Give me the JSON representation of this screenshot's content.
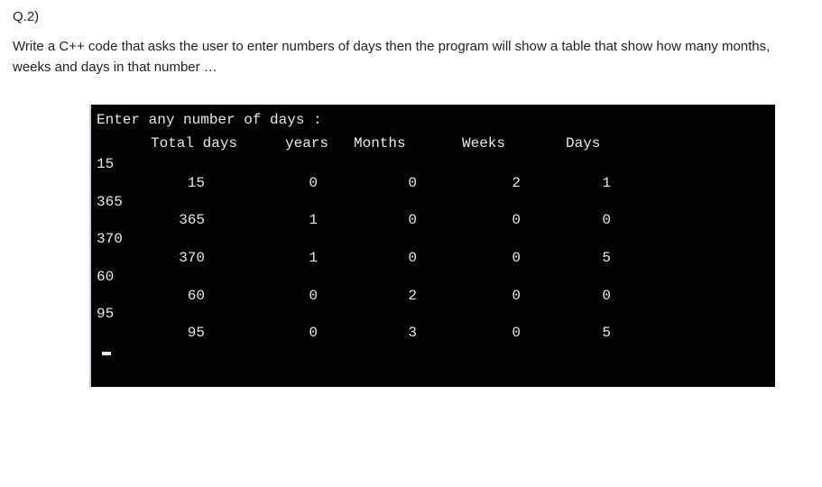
{
  "question_number": "Q.2)",
  "question_text": "Write  a C++ code that asks the user to enter numbers of days then the program will show a table that show how many months, weeks and days in that number …",
  "terminal": {
    "prompt": "Enter any number of days :",
    "headers": {
      "total_days": "Total days",
      "years": "years",
      "months": "Months",
      "weeks": "Weeks",
      "days": "Days"
    },
    "rows": [
      {
        "input": "15",
        "total_days": "15",
        "years": "0",
        "months": "0",
        "weeks": "2",
        "days": "1"
      },
      {
        "input": "365",
        "total_days": "365",
        "years": "1",
        "months": "0",
        "weeks": "0",
        "days": "0"
      },
      {
        "input": "370",
        "total_days": "370",
        "years": "1",
        "months": "0",
        "weeks": "0",
        "days": "5"
      },
      {
        "input": "60",
        "total_days": "60",
        "years": "0",
        "months": "2",
        "weeks": "0",
        "days": "0"
      },
      {
        "input": "95",
        "total_days": "95",
        "years": "0",
        "months": "3",
        "weeks": "0",
        "days": "5"
      }
    ]
  }
}
